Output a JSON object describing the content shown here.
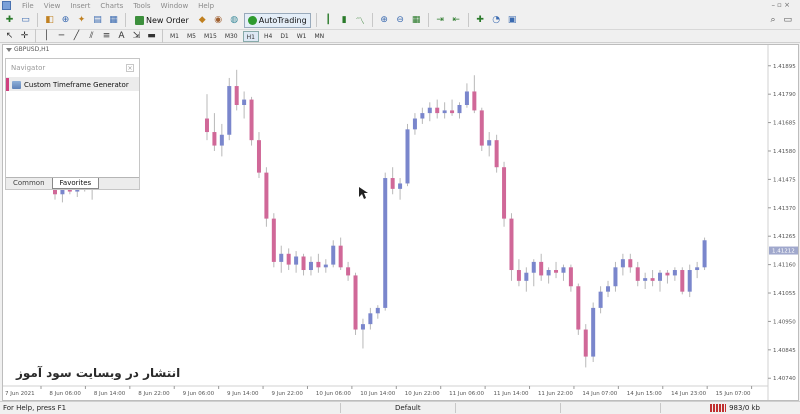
{
  "menu": {
    "items": [
      "File",
      "View",
      "Insert",
      "Charts",
      "Tools",
      "Window",
      "Help"
    ]
  },
  "toolbar": {
    "new_order_label": "New Order",
    "autotrading_label": "AutoTrading"
  },
  "timeframes": [
    "M1",
    "M5",
    "M15",
    "M30",
    "H1",
    "H4",
    "D1",
    "W1",
    "MN"
  ],
  "active_timeframe": "H1",
  "chart": {
    "window_title": "GBPUSD,H1"
  },
  "navigator": {
    "title": "Navigator",
    "item_label": "Custom Timeframe Generator",
    "tabs": [
      "Common",
      "Favorites"
    ],
    "active_tab": "Favorites"
  },
  "watermark": "انتشار در وبسایت سود آموز",
  "status": {
    "help_text": "For Help, press F1",
    "profile": "Default",
    "traffic": "983/0 kb"
  },
  "colors": {
    "bull": "#7a86cc",
    "bear": "#d06898",
    "current_price_bg": "#a0a8cc"
  },
  "chart_data": {
    "type": "candlestick",
    "symbol": "GBPUSD",
    "timeframe": "H1",
    "price_axis_labels": [
      "1.41895",
      "1.41790",
      "1.41685",
      "1.41580",
      "1.41475",
      "1.41370",
      "1.41265",
      "1.41160",
      "1.41055",
      "1.40950",
      "1.40845",
      "1.40740"
    ],
    "current_price_label": "1.41212",
    "time_axis_labels": [
      "7 Jun 2021",
      "8 Jun 06:00",
      "8 Jun 14:00",
      "8 Jun 22:00",
      "9 Jun 06:00",
      "9 Jun 14:00",
      "9 Jun 22:00",
      "10 Jun 06:00",
      "10 Jun 14:00",
      "10 Jun 22:00",
      "11 Jun 06:00",
      "11 Jun 14:00",
      "11 Jun 22:00",
      "14 Jun 07:00",
      "14 Jun 15:00",
      "14 Jun 23:00",
      "15 Jun 07:00"
    ],
    "candles": [
      {
        "o": 1.4148,
        "h": 1.4152,
        "l": 1.414,
        "c": 1.4142
      },
      {
        "o": 1.4142,
        "h": 1.4147,
        "l": 1.4139,
        "c": 1.4145
      },
      {
        "o": 1.4145,
        "h": 1.415,
        "l": 1.4142,
        "c": 1.4143
      },
      {
        "o": 1.4143,
        "h": 1.4148,
        "l": 1.4141,
        "c": 1.4146
      },
      {
        "o": 1.4146,
        "h": 1.4149,
        "l": 1.4143,
        "c": 1.4144
      },
      {
        "o": 1.4144,
        "h": 1.4148,
        "l": 1.414,
        "c": 1.4147
      },
      {
        "o": 1.4147,
        "h": 1.415,
        "l": 1.4145,
        "c": 1.4148
      },
      {
        "o": 1.417,
        "h": 1.4179,
        "l": 1.4162,
        "c": 1.4165
      },
      {
        "o": 1.4165,
        "h": 1.4172,
        "l": 1.4158,
        "c": 1.416
      },
      {
        "o": 1.416,
        "h": 1.4168,
        "l": 1.4156,
        "c": 1.4164
      },
      {
        "o": 1.4164,
        "h": 1.4185,
        "l": 1.4162,
        "c": 1.4182
      },
      {
        "o": 1.4182,
        "h": 1.4188,
        "l": 1.4173,
        "c": 1.4175
      },
      {
        "o": 1.4175,
        "h": 1.418,
        "l": 1.417,
        "c": 1.4177
      },
      {
        "o": 1.4177,
        "h": 1.4178,
        "l": 1.416,
        "c": 1.4162
      },
      {
        "o": 1.4162,
        "h": 1.4165,
        "l": 1.4148,
        "c": 1.415
      },
      {
        "o": 1.415,
        "h": 1.4152,
        "l": 1.413,
        "c": 1.4133
      },
      {
        "o": 1.4133,
        "h": 1.4135,
        "l": 1.4115,
        "c": 1.4117
      },
      {
        "o": 1.4117,
        "h": 1.4123,
        "l": 1.4113,
        "c": 1.412
      },
      {
        "o": 1.412,
        "h": 1.4122,
        "l": 1.4114,
        "c": 1.4116
      },
      {
        "o": 1.4116,
        "h": 1.4121,
        "l": 1.4113,
        "c": 1.4119
      },
      {
        "o": 1.4119,
        "h": 1.412,
        "l": 1.4112,
        "c": 1.4114
      },
      {
        "o": 1.4114,
        "h": 1.4119,
        "l": 1.4112,
        "c": 1.4117
      },
      {
        "o": 1.4117,
        "h": 1.412,
        "l": 1.4113,
        "c": 1.4115
      },
      {
        "o": 1.4115,
        "h": 1.4118,
        "l": 1.4113,
        "c": 1.4116
      },
      {
        "o": 1.4116,
        "h": 1.4125,
        "l": 1.4115,
        "c": 1.4123
      },
      {
        "o": 1.4123,
        "h": 1.4126,
        "l": 1.4114,
        "c": 1.4115
      },
      {
        "o": 1.4115,
        "h": 1.4117,
        "l": 1.411,
        "c": 1.4112
      },
      {
        "o": 1.4112,
        "h": 1.4113,
        "l": 1.409,
        "c": 1.4092
      },
      {
        "o": 1.4092,
        "h": 1.4096,
        "l": 1.4085,
        "c": 1.4094
      },
      {
        "o": 1.4094,
        "h": 1.41,
        "l": 1.4092,
        "c": 1.4098
      },
      {
        "o": 1.4098,
        "h": 1.4101,
        "l": 1.4096,
        "c": 1.41
      },
      {
        "o": 1.41,
        "h": 1.415,
        "l": 1.4099,
        "c": 1.4148
      },
      {
        "o": 1.4148,
        "h": 1.4152,
        "l": 1.4142,
        "c": 1.4144
      },
      {
        "o": 1.4144,
        "h": 1.4148,
        "l": 1.414,
        "c": 1.4146
      },
      {
        "o": 1.4146,
        "h": 1.4168,
        "l": 1.4145,
        "c": 1.4166
      },
      {
        "o": 1.4166,
        "h": 1.4172,
        "l": 1.4164,
        "c": 1.417
      },
      {
        "o": 1.417,
        "h": 1.4174,
        "l": 1.4168,
        "c": 1.4172
      },
      {
        "o": 1.4172,
        "h": 1.4176,
        "l": 1.4169,
        "c": 1.4174
      },
      {
        "o": 1.4174,
        "h": 1.4177,
        "l": 1.417,
        "c": 1.4172
      },
      {
        "o": 1.4172,
        "h": 1.4176,
        "l": 1.417,
        "c": 1.4173
      },
      {
        "o": 1.4173,
        "h": 1.4177,
        "l": 1.4171,
        "c": 1.4172
      },
      {
        "o": 1.4172,
        "h": 1.4176,
        "l": 1.417,
        "c": 1.4175
      },
      {
        "o": 1.4175,
        "h": 1.4183,
        "l": 1.4174,
        "c": 1.418
      },
      {
        "o": 1.418,
        "h": 1.4186,
        "l": 1.4172,
        "c": 1.4173
      },
      {
        "o": 1.4173,
        "h": 1.4174,
        "l": 1.4158,
        "c": 1.416
      },
      {
        "o": 1.416,
        "h": 1.4165,
        "l": 1.4156,
        "c": 1.4162
      },
      {
        "o": 1.4162,
        "h": 1.4164,
        "l": 1.415,
        "c": 1.4152
      },
      {
        "o": 1.4152,
        "h": 1.4154,
        "l": 1.413,
        "c": 1.4133
      },
      {
        "o": 1.4133,
        "h": 1.4135,
        "l": 1.411,
        "c": 1.4114
      },
      {
        "o": 1.4114,
        "h": 1.4118,
        "l": 1.4108,
        "c": 1.411
      },
      {
        "o": 1.411,
        "h": 1.4115,
        "l": 1.4106,
        "c": 1.4113
      },
      {
        "o": 1.4113,
        "h": 1.4118,
        "l": 1.4108,
        "c": 1.4117
      },
      {
        "o": 1.4117,
        "h": 1.412,
        "l": 1.411,
        "c": 1.4112
      },
      {
        "o": 1.4112,
        "h": 1.4115,
        "l": 1.4109,
        "c": 1.4114
      },
      {
        "o": 1.4114,
        "h": 1.4117,
        "l": 1.4111,
        "c": 1.4113
      },
      {
        "o": 1.4113,
        "h": 1.4116,
        "l": 1.411,
        "c": 1.4115
      },
      {
        "o": 1.4115,
        "h": 1.4116,
        "l": 1.4106,
        "c": 1.4108
      },
      {
        "o": 1.4108,
        "h": 1.4109,
        "l": 1.409,
        "c": 1.4092
      },
      {
        "o": 1.4092,
        "h": 1.4094,
        "l": 1.4078,
        "c": 1.4082
      },
      {
        "o": 1.4082,
        "h": 1.4102,
        "l": 1.408,
        "c": 1.41
      },
      {
        "o": 1.41,
        "h": 1.4108,
        "l": 1.4098,
        "c": 1.4106
      },
      {
        "o": 1.4106,
        "h": 1.411,
        "l": 1.4104,
        "c": 1.4108
      },
      {
        "o": 1.4108,
        "h": 1.4117,
        "l": 1.4106,
        "c": 1.4115
      },
      {
        "o": 1.4115,
        "h": 1.412,
        "l": 1.4112,
        "c": 1.4118
      },
      {
        "o": 1.4118,
        "h": 1.412,
        "l": 1.4113,
        "c": 1.4115
      },
      {
        "o": 1.4115,
        "h": 1.4117,
        "l": 1.4108,
        "c": 1.411
      },
      {
        "o": 1.411,
        "h": 1.4113,
        "l": 1.4107,
        "c": 1.4111
      },
      {
        "o": 1.4111,
        "h": 1.4114,
        "l": 1.4108,
        "c": 1.411
      },
      {
        "o": 1.411,
        "h": 1.4114,
        "l": 1.4106,
        "c": 1.4113
      },
      {
        "o": 1.4113,
        "h": 1.4114,
        "l": 1.4109,
        "c": 1.4112
      },
      {
        "o": 1.4112,
        "h": 1.4115,
        "l": 1.411,
        "c": 1.4114
      },
      {
        "o": 1.4114,
        "h": 1.4115,
        "l": 1.4105,
        "c": 1.4106
      },
      {
        "o": 1.4106,
        "h": 1.4116,
        "l": 1.4104,
        "c": 1.4114
      },
      {
        "o": 1.4114,
        "h": 1.4117,
        "l": 1.4111,
        "c": 1.4115
      },
      {
        "o": 1.4115,
        "h": 1.4126,
        "l": 1.4114,
        "c": 1.4125
      }
    ]
  }
}
